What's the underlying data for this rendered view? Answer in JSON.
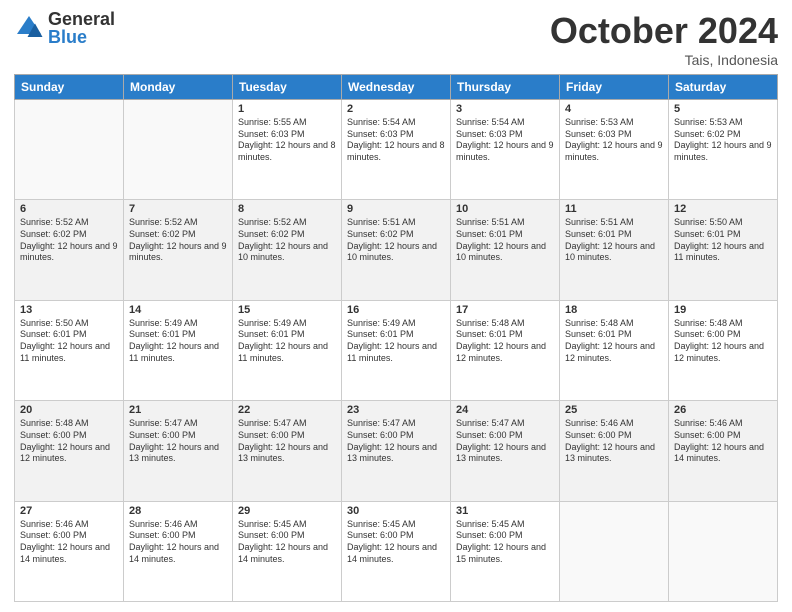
{
  "header": {
    "logo_general": "General",
    "logo_blue": "Blue",
    "month_title": "October 2024",
    "subtitle": "Tais, Indonesia"
  },
  "days_of_week": [
    "Sunday",
    "Monday",
    "Tuesday",
    "Wednesday",
    "Thursday",
    "Friday",
    "Saturday"
  ],
  "weeks": [
    [
      {
        "day": "",
        "info": ""
      },
      {
        "day": "",
        "info": ""
      },
      {
        "day": "1",
        "info": "Sunrise: 5:55 AM\nSunset: 6:03 PM\nDaylight: 12 hours and 8 minutes."
      },
      {
        "day": "2",
        "info": "Sunrise: 5:54 AM\nSunset: 6:03 PM\nDaylight: 12 hours and 8 minutes."
      },
      {
        "day": "3",
        "info": "Sunrise: 5:54 AM\nSunset: 6:03 PM\nDaylight: 12 hours and 9 minutes."
      },
      {
        "day": "4",
        "info": "Sunrise: 5:53 AM\nSunset: 6:03 PM\nDaylight: 12 hours and 9 minutes."
      },
      {
        "day": "5",
        "info": "Sunrise: 5:53 AM\nSunset: 6:02 PM\nDaylight: 12 hours and 9 minutes."
      }
    ],
    [
      {
        "day": "6",
        "info": "Sunrise: 5:52 AM\nSunset: 6:02 PM\nDaylight: 12 hours and 9 minutes."
      },
      {
        "day": "7",
        "info": "Sunrise: 5:52 AM\nSunset: 6:02 PM\nDaylight: 12 hours and 9 minutes."
      },
      {
        "day": "8",
        "info": "Sunrise: 5:52 AM\nSunset: 6:02 PM\nDaylight: 12 hours and 10 minutes."
      },
      {
        "day": "9",
        "info": "Sunrise: 5:51 AM\nSunset: 6:02 PM\nDaylight: 12 hours and 10 minutes."
      },
      {
        "day": "10",
        "info": "Sunrise: 5:51 AM\nSunset: 6:01 PM\nDaylight: 12 hours and 10 minutes."
      },
      {
        "day": "11",
        "info": "Sunrise: 5:51 AM\nSunset: 6:01 PM\nDaylight: 12 hours and 10 minutes."
      },
      {
        "day": "12",
        "info": "Sunrise: 5:50 AM\nSunset: 6:01 PM\nDaylight: 12 hours and 11 minutes."
      }
    ],
    [
      {
        "day": "13",
        "info": "Sunrise: 5:50 AM\nSunset: 6:01 PM\nDaylight: 12 hours and 11 minutes."
      },
      {
        "day": "14",
        "info": "Sunrise: 5:49 AM\nSunset: 6:01 PM\nDaylight: 12 hours and 11 minutes."
      },
      {
        "day": "15",
        "info": "Sunrise: 5:49 AM\nSunset: 6:01 PM\nDaylight: 12 hours and 11 minutes."
      },
      {
        "day": "16",
        "info": "Sunrise: 5:49 AM\nSunset: 6:01 PM\nDaylight: 12 hours and 11 minutes."
      },
      {
        "day": "17",
        "info": "Sunrise: 5:48 AM\nSunset: 6:01 PM\nDaylight: 12 hours and 12 minutes."
      },
      {
        "day": "18",
        "info": "Sunrise: 5:48 AM\nSunset: 6:01 PM\nDaylight: 12 hours and 12 minutes."
      },
      {
        "day": "19",
        "info": "Sunrise: 5:48 AM\nSunset: 6:00 PM\nDaylight: 12 hours and 12 minutes."
      }
    ],
    [
      {
        "day": "20",
        "info": "Sunrise: 5:48 AM\nSunset: 6:00 PM\nDaylight: 12 hours and 12 minutes."
      },
      {
        "day": "21",
        "info": "Sunrise: 5:47 AM\nSunset: 6:00 PM\nDaylight: 12 hours and 13 minutes."
      },
      {
        "day": "22",
        "info": "Sunrise: 5:47 AM\nSunset: 6:00 PM\nDaylight: 12 hours and 13 minutes."
      },
      {
        "day": "23",
        "info": "Sunrise: 5:47 AM\nSunset: 6:00 PM\nDaylight: 12 hours and 13 minutes."
      },
      {
        "day": "24",
        "info": "Sunrise: 5:47 AM\nSunset: 6:00 PM\nDaylight: 12 hours and 13 minutes."
      },
      {
        "day": "25",
        "info": "Sunrise: 5:46 AM\nSunset: 6:00 PM\nDaylight: 12 hours and 13 minutes."
      },
      {
        "day": "26",
        "info": "Sunrise: 5:46 AM\nSunset: 6:00 PM\nDaylight: 12 hours and 14 minutes."
      }
    ],
    [
      {
        "day": "27",
        "info": "Sunrise: 5:46 AM\nSunset: 6:00 PM\nDaylight: 12 hours and 14 minutes."
      },
      {
        "day": "28",
        "info": "Sunrise: 5:46 AM\nSunset: 6:00 PM\nDaylight: 12 hours and 14 minutes."
      },
      {
        "day": "29",
        "info": "Sunrise: 5:45 AM\nSunset: 6:00 PM\nDaylight: 12 hours and 14 minutes."
      },
      {
        "day": "30",
        "info": "Sunrise: 5:45 AM\nSunset: 6:00 PM\nDaylight: 12 hours and 14 minutes."
      },
      {
        "day": "31",
        "info": "Sunrise: 5:45 AM\nSunset: 6:00 PM\nDaylight: 12 hours and 15 minutes."
      },
      {
        "day": "",
        "info": ""
      },
      {
        "day": "",
        "info": ""
      }
    ]
  ]
}
